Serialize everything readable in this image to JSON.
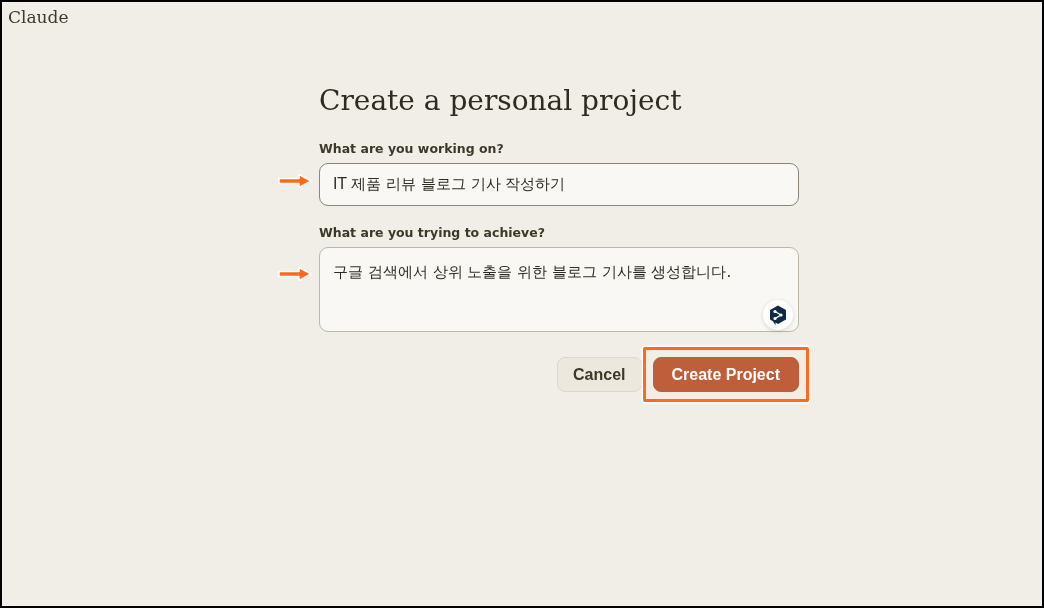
{
  "app": {
    "name": "Claude"
  },
  "dialog": {
    "title": "Create a personal project",
    "fields": [
      {
        "kind": "input",
        "label": "What are you working on?",
        "value": "IT 제품 리뷰 블로그 기사 작성하기",
        "annotated": true
      },
      {
        "kind": "textarea",
        "label": "What are you trying to achieve?",
        "value": "구글 검색에서 상위 노출을 위한 블로그 기사를 생성합니다.",
        "annotated": true,
        "extension_badge": true
      }
    ],
    "buttons": [
      {
        "kind": "secondary",
        "label": "Cancel"
      },
      {
        "kind": "primary",
        "label": "Create Project",
        "highlighted": true
      }
    ]
  }
}
